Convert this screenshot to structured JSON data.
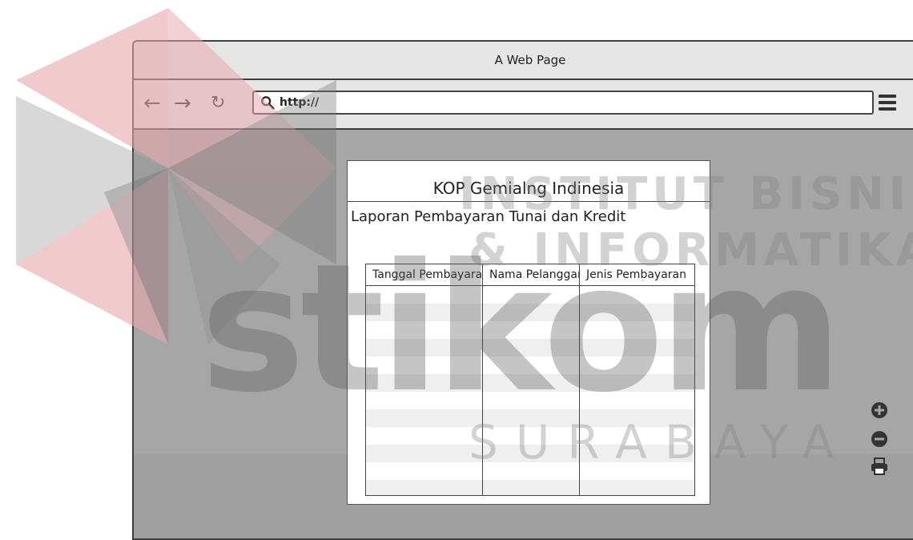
{
  "window": {
    "title": "A Web Page"
  },
  "toolbar": {
    "back_icon": "arrow-left-icon",
    "forward_icon": "arrow-right-icon",
    "reload_icon": "reload-icon",
    "url_value": "http://",
    "menu_icon": "hamburger-menu-icon"
  },
  "report": {
    "kop": "KOP Gemialng Indinesia",
    "title": "Laporan Pembayaran Tunai dan Kredit",
    "columns": [
      "Tanggal Pembayaran",
      "Nama Pelanggan",
      "Jenis Pembayaran"
    ],
    "rows": [
      [
        "",
        "",
        ""
      ],
      [
        "",
        "",
        ""
      ],
      [
        "",
        "",
        ""
      ],
      [
        "",
        "",
        ""
      ],
      [
        "",
        "",
        ""
      ],
      [
        "",
        "",
        ""
      ],
      [
        "",
        "",
        ""
      ],
      [
        "",
        "",
        ""
      ],
      [
        "",
        "",
        ""
      ],
      [
        "",
        "",
        ""
      ],
      [
        "",
        "",
        ""
      ],
      [
        "",
        "",
        ""
      ]
    ]
  },
  "side_controls": [
    "zoom-in-icon",
    "zoom-out-icon",
    "print-icon"
  ],
  "watermark": {
    "line1": "INSTITUT BISNIS",
    "line2": "& INFORMATIKA",
    "logo": "stikom",
    "city": "SURABAYA"
  },
  "colors": {
    "window_chrome": "#e5e5e5",
    "content_bg": "#a6a6a6",
    "watermark_red": "#e8a7ad",
    "watermark_gray": "#8c8c8c"
  }
}
